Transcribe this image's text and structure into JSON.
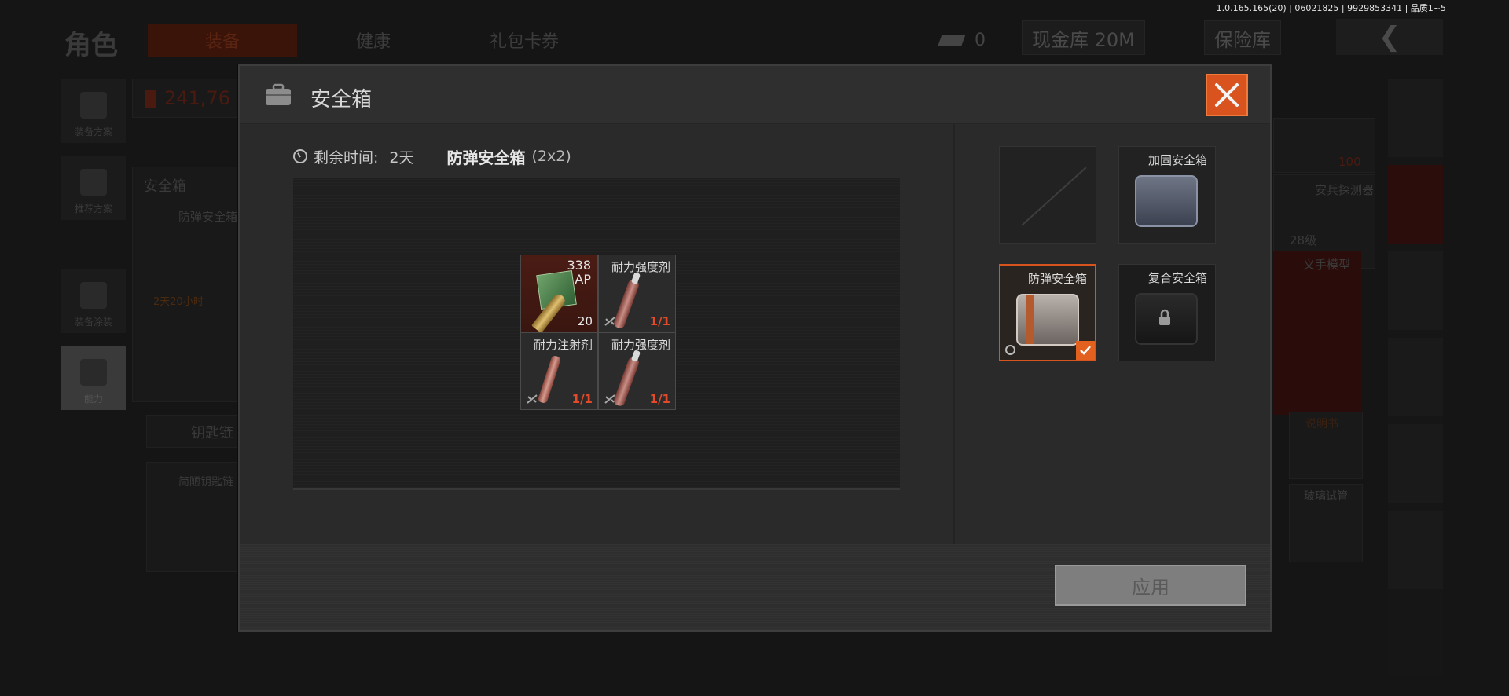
{
  "version": "1.0.165.165(20) | 06021825 | 9929853341 | 品质1~5",
  "background": {
    "title": "角色",
    "tabs": [
      "装备",
      "健康",
      "礼包卡券"
    ],
    "ticket_count": "0",
    "cash_vault": "现金库 20M",
    "insurance_vault": "保险库",
    "money": "241,76",
    "side_buttons": [
      "装备方案",
      "推荐方案",
      "装备涂装",
      "能力"
    ],
    "safebox_label": "安全箱",
    "safebox_item": "防弹安全箱",
    "safebox_timer": "2天20小时",
    "keychain_label": "钥匙链",
    "keychain_item": "简陋钥匙链",
    "right_labels": [
      "100",
      "安兵探测器",
      "28级",
      "义手模型",
      "说明书",
      "玻璃试管"
    ]
  },
  "modal": {
    "title": "安全箱",
    "remaining_label": "剩余时间:",
    "remaining_value": "2天",
    "case_name": "防弹安全箱",
    "case_size": "(2x2)",
    "items": [
      {
        "name": "",
        "caliber_line1": "338",
        "caliber_line2": "AP",
        "count": "20",
        "type": "ammo"
      },
      {
        "name": "耐力强度剂",
        "durability": "1/1",
        "type": "syringe"
      },
      {
        "name": "耐力注射剂",
        "durability": "1/1",
        "type": "injector"
      },
      {
        "name": "耐力强度剂",
        "durability": "1/1",
        "type": "syringe"
      }
    ],
    "cases": [
      {
        "name": "",
        "state": "empty"
      },
      {
        "name": "加固安全箱",
        "state": "available"
      },
      {
        "name": "防弹安全箱",
        "state": "selected"
      },
      {
        "name": "复合安全箱",
        "state": "locked"
      }
    ],
    "apply_label": "应用"
  },
  "colors": {
    "accent": "#d9531e",
    "durability_red": "#e24a2a",
    "check_orange": "#e2611f"
  }
}
